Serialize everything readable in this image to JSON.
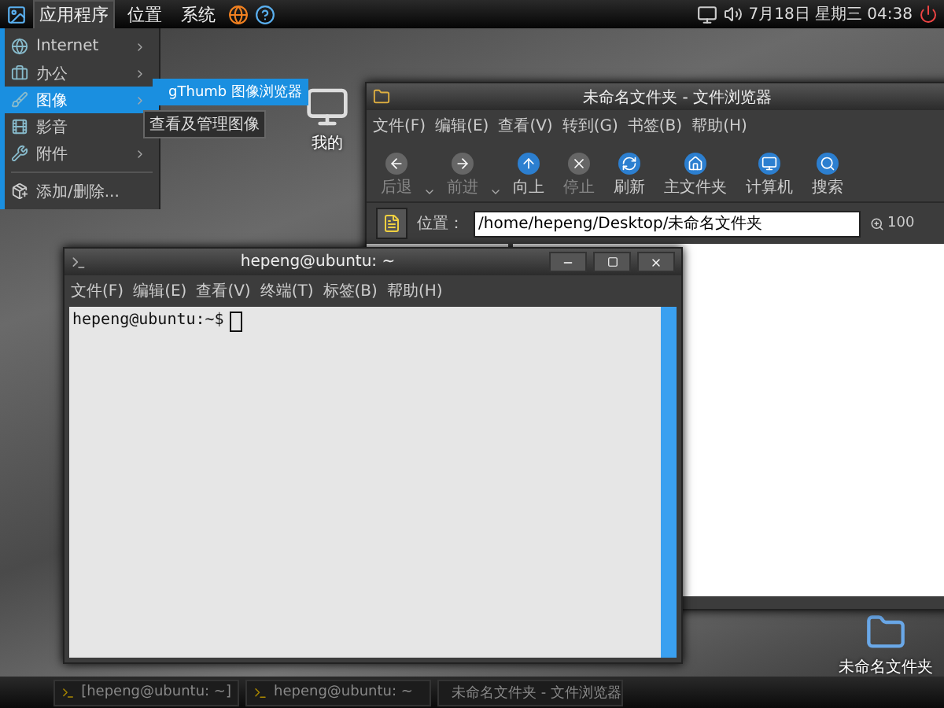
{
  "top_panel": {
    "menus": [
      {
        "label": "应用程序",
        "selected": true
      },
      {
        "label": "位置",
        "selected": false
      },
      {
        "label": "系统",
        "selected": false
      }
    ],
    "clock": "7月18日 星期三 04:38"
  },
  "app_menu": {
    "items": [
      {
        "label": "Internet",
        "submenu": true,
        "selected": false
      },
      {
        "label": "办公",
        "submenu": true,
        "selected": false
      },
      {
        "label": "图像",
        "submenu": true,
        "selected": true
      },
      {
        "label": "影音",
        "submenu": false,
        "selected": false
      },
      {
        "label": "附件",
        "submenu": true,
        "selected": false
      }
    ],
    "footer_items": [
      {
        "label": "添加/删除...",
        "selected": false
      }
    ]
  },
  "submenu": {
    "items": [
      {
        "label": "gThumb 图像浏览器",
        "selected": true
      }
    ],
    "tooltip": "查看及管理图像"
  },
  "desktop_icons": [
    {
      "label": "我的"
    },
    {
      "label": "未命名文件夹"
    }
  ],
  "file_browser": {
    "title": "未命名文件夹 - 文件浏览器",
    "menus": [
      "文件(F)",
      "编辑(E)",
      "查看(V)",
      "转到(G)",
      "书签(B)",
      "帮助(H)"
    ],
    "toolbar": [
      {
        "kind": "back",
        "label": "后退",
        "disabled": true,
        "dropdown": true
      },
      {
        "kind": "forward",
        "label": "前进",
        "disabled": true,
        "dropdown": true
      },
      {
        "kind": "up",
        "label": "向上",
        "disabled": false,
        "dropdown": false
      },
      {
        "kind": "stop",
        "label": "停止",
        "disabled": true,
        "dropdown": false
      },
      {
        "kind": "reload",
        "label": "刷新",
        "disabled": false,
        "dropdown": false
      },
      {
        "kind": "home",
        "label": "主文件夹",
        "disabled": false,
        "dropdown": false
      },
      {
        "kind": "computer",
        "label": "计算机",
        "disabled": false,
        "dropdown": false
      },
      {
        "kind": "search",
        "label": "搜索",
        "disabled": false,
        "dropdown": false
      }
    ],
    "location_label": "位置：",
    "path": "/home/hepeng/Desktop/未命名文件夹",
    "zoom": "100"
  },
  "terminal": {
    "title": "hepeng@ubuntu: ~",
    "menus": [
      "文件(F)",
      "编辑(E)",
      "查看(V)",
      "终端(T)",
      "标签(B)",
      "帮助(H)"
    ],
    "prompt": "hepeng@ubuntu:~$"
  },
  "taskbar": {
    "items": [
      {
        "kind": "terminal",
        "label": "[hepeng@ubuntu: ~]",
        "selected": false
      },
      {
        "kind": "terminal",
        "label": "hepeng@ubuntu: ~",
        "selected": false
      },
      {
        "kind": "folder",
        "label": "未命名文件夹 - 文件浏览器",
        "selected": false
      }
    ]
  }
}
